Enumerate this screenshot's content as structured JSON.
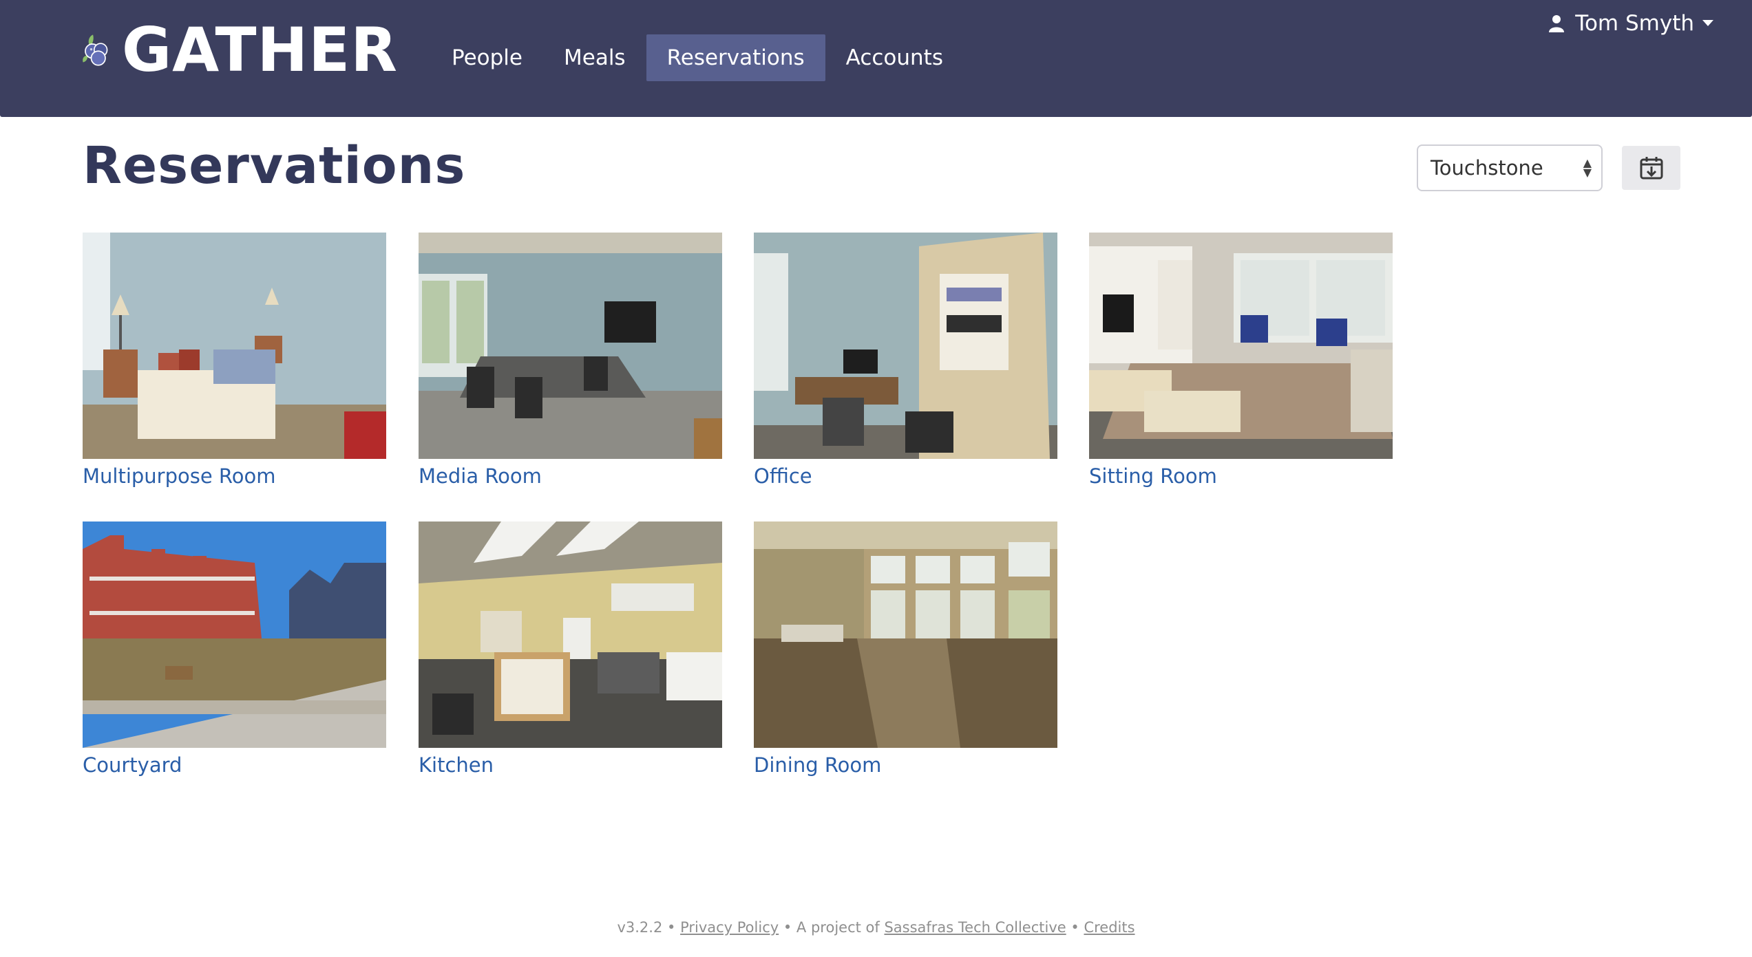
{
  "app": {
    "logo_text": "GATHER",
    "nav": [
      {
        "label": "People"
      },
      {
        "label": "Meals"
      },
      {
        "label": "Reservations",
        "active": true
      },
      {
        "label": "Accounts"
      }
    ],
    "user": {
      "name": "Tom Smyth",
      "icon": "user-icon"
    }
  },
  "page": {
    "title": "Reservations",
    "community_select": {
      "value": "Touchstone"
    },
    "calendar_button_icon": "calendar-download-icon"
  },
  "resources": [
    {
      "name": "Multipurpose Room"
    },
    {
      "name": "Media Room"
    },
    {
      "name": "Office"
    },
    {
      "name": "Sitting Room"
    },
    {
      "name": "Courtyard"
    },
    {
      "name": "Kitchen"
    },
    {
      "name": "Dining Room"
    }
  ],
  "footer": {
    "version": "v3.2.2",
    "sep1": " • ",
    "privacy": "Privacy Policy",
    "project_prefix": " • A project of ",
    "collective": "Sassafras Tech Collective",
    "sep2": " • ",
    "credits": "Credits"
  },
  "colors": {
    "navbar": "#3c3f5f",
    "nav_active": "#58608f",
    "link": "#2a5ea8",
    "title": "#33385a"
  }
}
